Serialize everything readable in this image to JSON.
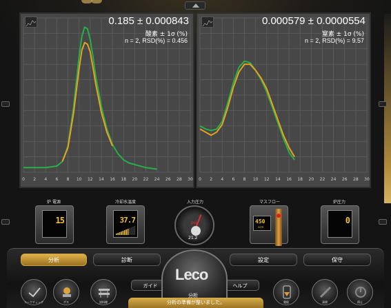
{
  "charts": {
    "oxygen": {
      "result": "0.185 ± 0.000843",
      "label": "酸素 ± 1σ (%)",
      "stats": "n = 2, RSD(%) = 0.456"
    },
    "nitrogen": {
      "result": "0.000579 ± 0.0000554",
      "label": "窒素 ± 1σ (%)",
      "stats": "n = 2, RSD(%) = 9.57"
    }
  },
  "chart_data": [
    {
      "type": "line",
      "x_ticks": [
        0,
        2,
        4,
        6,
        8,
        10,
        12,
        14,
        16,
        18,
        20,
        22,
        24,
        26,
        28,
        30
      ],
      "xlim": [
        0,
        30
      ],
      "ylim": [
        0,
        1
      ],
      "grid": true,
      "series": [
        {
          "color": "#27b04a",
          "x": [
            0,
            4,
            6,
            7,
            8,
            9,
            10,
            10.5,
            11,
            11.5,
            12,
            12.5,
            13,
            14,
            15,
            16,
            17,
            18,
            19,
            20,
            22,
            24
          ],
          "y": [
            0.03,
            0.03,
            0.04,
            0.07,
            0.17,
            0.42,
            0.75,
            0.88,
            0.94,
            0.93,
            0.86,
            0.75,
            0.62,
            0.43,
            0.28,
            0.18,
            0.12,
            0.08,
            0.06,
            0.05,
            0.03,
            0.02
          ]
        },
        {
          "color": "#e8a020",
          "x": [
            7,
            8,
            9,
            10,
            10.5,
            11,
            11.5,
            12,
            12.5,
            13,
            14,
            15,
            16
          ],
          "y": [
            0.07,
            0.16,
            0.38,
            0.67,
            0.79,
            0.84,
            0.83,
            0.78,
            0.68,
            0.57,
            0.39,
            0.26,
            0.17
          ]
        }
      ]
    },
    {
      "type": "line",
      "x_ticks": [
        0,
        2,
        4,
        6,
        8,
        10,
        12,
        14,
        16,
        18,
        20,
        22,
        24,
        26,
        28,
        30
      ],
      "xlim": [
        0,
        30
      ],
      "ylim": [
        0,
        1
      ],
      "grid": true,
      "series": [
        {
          "color": "#27b04a",
          "x": [
            0,
            1,
            2,
            3,
            4,
            5,
            6,
            7,
            8,
            9,
            10,
            11,
            12,
            13,
            14,
            15,
            16,
            17
          ],
          "y": [
            0.3,
            0.28,
            0.27,
            0.28,
            0.33,
            0.45,
            0.58,
            0.68,
            0.72,
            0.71,
            0.66,
            0.6,
            0.52,
            0.42,
            0.32,
            0.22,
            0.13,
            0.08
          ]
        },
        {
          "color": "#e8a020",
          "x": [
            0,
            1,
            2,
            3,
            4,
            5,
            6,
            7,
            8,
            9,
            10,
            11,
            12,
            13,
            14,
            15,
            16,
            17
          ],
          "y": [
            0.28,
            0.26,
            0.24,
            0.26,
            0.31,
            0.42,
            0.55,
            0.65,
            0.7,
            0.7,
            0.66,
            0.61,
            0.54,
            0.44,
            0.34,
            0.24,
            0.16,
            0.1
          ]
        }
      ]
    }
  ],
  "gauges": {
    "furnace_power": {
      "label": "炉 電源",
      "value": "15"
    },
    "cooling_water": {
      "label": "冷却水温度",
      "value": "37.7",
      "level": 0.6
    },
    "input_pressure": {
      "label": "入力圧力",
      "unit": "psi",
      "value": "21.2"
    },
    "mass_flow": {
      "label": "マスフロー",
      "value": "450",
      "unit": "ccm",
      "level": 0.85
    },
    "furnace_pressure": {
      "label": "炉圧力",
      "value": "0"
    }
  },
  "tabs": {
    "analysis": "分析",
    "diagnostics": "診断",
    "settings": "設定",
    "maintenance": "保守"
  },
  "logo": {
    "text": "Leco",
    "sub": "分析"
  },
  "buttons": {
    "guide": "ガイド",
    "help": "ヘルプ"
  },
  "round_buttons": {
    "leak_check": "リークチェック",
    "boat": "ボス",
    "sample_rack": "試料棚",
    "electrode": "電極",
    "clean": "清掃",
    "stop": "停止"
  },
  "status": "分析の準備が整いました。"
}
